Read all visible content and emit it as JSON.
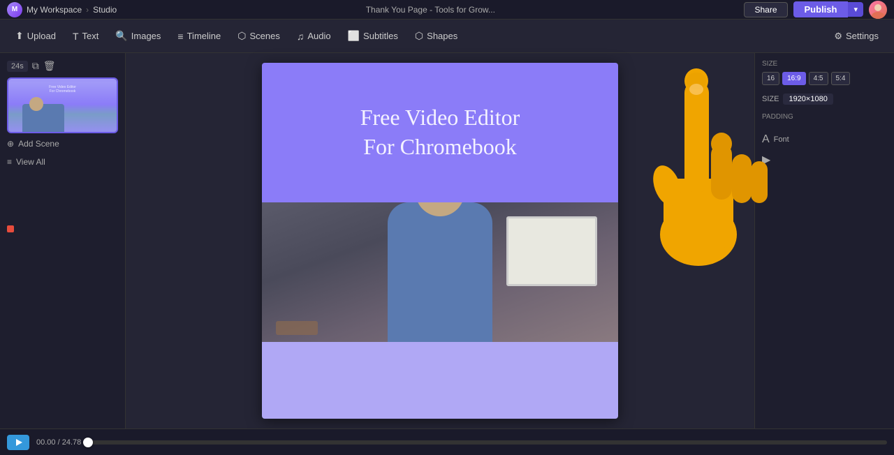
{
  "topbar": {
    "workspace_label": "My Workspace",
    "breadcrumb_sep": "›",
    "studio_label": "Studio",
    "page_title": "Thank You Page - Tools for Grow...",
    "share_label": "Share",
    "publish_label": "Publish",
    "settings_label": "Settings"
  },
  "toolbar": {
    "upload_label": "Upload",
    "text_label": "Text",
    "images_label": "Images",
    "timeline_label": "Timeline",
    "scenes_label": "Scenes",
    "audio_label": "Audio",
    "subtitles_label": "Subtitles",
    "shapes_label": "Shapes",
    "settings_label": "Settings"
  },
  "sidebar": {
    "duration_label": "24s",
    "add_scene_label": "Add Scene",
    "view_all_label": "View All"
  },
  "canvas": {
    "title_line1": "Free Video Editor",
    "title_line2": "For Chromebook"
  },
  "right_panel": {
    "size_label": "SIZE",
    "padding_label": "PADDING",
    "aspect_options": [
      "16",
      "16:9",
      "4:5",
      "5:4"
    ],
    "active_aspect": "16:9",
    "font_label": "Font"
  },
  "timeline": {
    "time_current": "00.00",
    "time_total": "24.78"
  }
}
